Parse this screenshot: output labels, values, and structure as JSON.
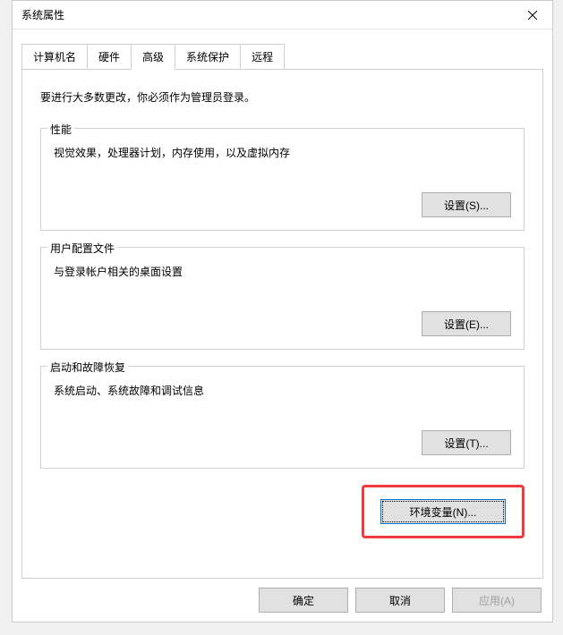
{
  "window": {
    "title": "系统属性"
  },
  "tabs": {
    "computer_name": "计算机名",
    "hardware": "硬件",
    "advanced": "高级",
    "system_protection": "系统保护",
    "remote": "远程"
  },
  "content": {
    "admin_note": "要进行大多数更改，你必须作为管理员登录。",
    "performance": {
      "title": "性能",
      "desc": "视觉效果，处理器计划，内存使用，以及虚拟内存",
      "button": "设置(S)..."
    },
    "user_profiles": {
      "title": "用户配置文件",
      "desc": "与登录帐户相关的桌面设置",
      "button": "设置(E)..."
    },
    "startup_recovery": {
      "title": "启动和故障恢复",
      "desc": "系统启动、系统故障和调试信息",
      "button": "设置(T)..."
    },
    "env_vars_button": "环境变量(N)..."
  },
  "buttons": {
    "ok": "确定",
    "cancel": "取消",
    "apply": "应用(A)"
  }
}
